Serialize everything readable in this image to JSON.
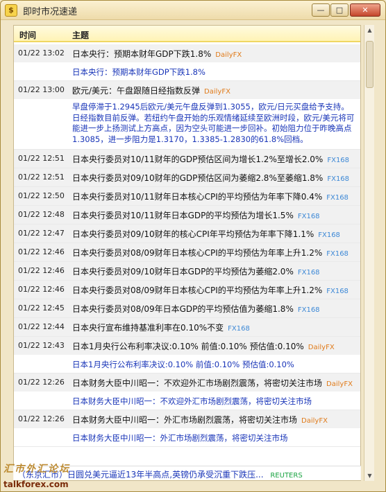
{
  "window": {
    "title": "即时市况速递",
    "icon_name": "app-icon",
    "min_label": "—",
    "max_label": "□",
    "close_label": "✕"
  },
  "table": {
    "col_time": "时间",
    "col_subject": "主题"
  },
  "rows": [
    {
      "time": "01/22 13:02",
      "title": "日本央行：预期本财年GDP下跌1.8%",
      "source": "DailyFX",
      "detail": "日本央行：预期本财年GDP下跌1.8%"
    },
    {
      "time": "01/22 13:00",
      "title": "欧元/美元：午盘跟随日经指数反弹",
      "source": "DailyFX",
      "detail": "早盘停滞于1.2945后欧元/美元午盘反弹到1.3055，欧元/日元买盘给予支持。日经指数目前反弹。若纽约午盘开始的乐观情绪延续至欧洲时段，欧元/美元将可能进一步上扬测试上方高点，因为空头可能进一步回补。初始阻力位于昨晚高点1.3085，进一步阻力是1.3170，1.3385-1.2830的61.8%回档。"
    },
    {
      "time": "01/22 12:51",
      "title": "日本央行委员对10/11财年的GDP预估区间为增长1.2%至增长2.0%",
      "source": "FX168"
    },
    {
      "time": "01/22 12:51",
      "title": "日本央行委员对09/10财年的GDP预估区间为萎缩2.8%至萎缩1.8%",
      "source": "FX168"
    },
    {
      "time": "01/22 12:50",
      "title": "日本央行委员对10/11财年日本核心CPI的平均预估为年率下降0.4%",
      "source": "FX168"
    },
    {
      "time": "01/22 12:48",
      "title": "日本央行委员对10/11财年日本GDP的平均预估为增长1.5%",
      "source": "FX168"
    },
    {
      "time": "01/22 12:47",
      "title": "日本央行委员对09/10财年的核心CPI年平均预估为年率下降1.1%",
      "source": "FX168"
    },
    {
      "time": "01/22 12:46",
      "title": "日本央行委员对08/09财年日本核心CPI的平均预估为年率上升1.2%",
      "source": "FX168"
    },
    {
      "time": "01/22 12:46",
      "title": "日本央行委员对09/10财年日本GDP的平均预估为萎缩2.0%",
      "source": "FX168"
    },
    {
      "time": "01/22 12:46",
      "title": "日本央行委员对08/09财年日本核心CPI的平均预估为年率上升1.2%",
      "source": "FX168"
    },
    {
      "time": "01/22 12:45",
      "title": "日本央行委员对08/09年日本GDP的平均预估值为萎缩1.8%",
      "source": "FX168"
    },
    {
      "time": "01/22 12:44",
      "title": "日本央行宣布维持基准利率在0.10%不变",
      "source": "FX168"
    },
    {
      "time": "01/22 12:43",
      "title": "日本1月央行公布利率决议:0.10% 前值:0.10% 预估值:0.10%",
      "source": "DailyFX",
      "detail": "日本1月央行公布利率决议:0.10% 前值:0.10% 预估值:0.10%"
    },
    {
      "time": "01/22 12:26",
      "title": "日本财务大臣中川昭一：不欢迎外汇市场剧烈震荡，将密切关注市场",
      "source": "DailyFX",
      "detail": "日本财务大臣中川昭一：不欢迎外汇市场剧烈震荡，将密切关注市场"
    },
    {
      "time": "01/22 12:26",
      "title": "日本财务大臣中川昭一：外汇市场剧烈震荡，将密切关注市场",
      "source": "DailyFX",
      "detail": "日本财务大臣中川昭一：外汇市场剧烈震荡，将密切关注市场"
    }
  ],
  "ticker": {
    "text": "（东京汇市）日圆兑美元逼近13年半高点,英镑仍承受沉重下跌压...",
    "source": "REUTERS"
  },
  "watermark": {
    "cn": "汇市外汇论坛",
    "en": "talkforex.com"
  },
  "colors": {
    "detail_text": "#1935b8",
    "dailyfx": "#e07a19",
    "fx168": "#3c88d6",
    "reuters": "#19a341"
  }
}
